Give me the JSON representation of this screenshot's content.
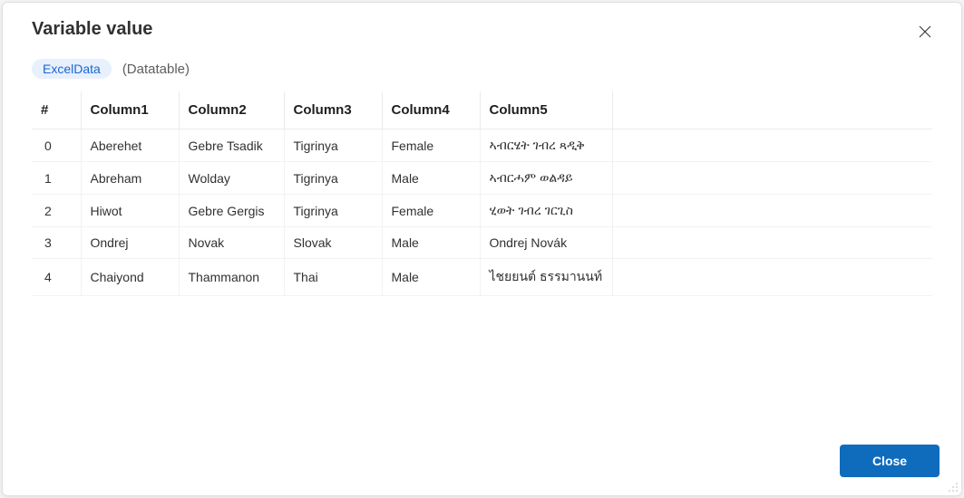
{
  "dialog": {
    "title": "Variable value",
    "variable_name": "ExcelData",
    "variable_type": "(Datatable)",
    "close_button_label": "Close"
  },
  "table": {
    "headers": {
      "index": "#",
      "c1": "Column1",
      "c2": "Column2",
      "c3": "Column3",
      "c4": "Column4",
      "c5": "Column5"
    },
    "rows": [
      {
        "index": "0",
        "c1": "Aberehet",
        "c2": "Gebre Tsadik",
        "c3": "Tigrinya",
        "c4": "Female",
        "c5": "ኣብርሄት ገብረ ጻዲቅ"
      },
      {
        "index": "1",
        "c1": "Abreham",
        "c2": "Wolday",
        "c3": "Tigrinya",
        "c4": "Male",
        "c5": "ኣብርሓም ወልዳይ"
      },
      {
        "index": "2",
        "c1": "Hiwot",
        "c2": "Gebre Gergis",
        "c3": "Tigrinya",
        "c4": "Female",
        "c5": "ሂወት ገብረ ገርጊስ"
      },
      {
        "index": "3",
        "c1": "Ondrej",
        "c2": "Novak",
        "c3": "Slovak",
        "c4": "Male",
        "c5": "Ondrej Novák"
      },
      {
        "index": "4",
        "c1": "Chaiyond",
        "c2": "Thammanon",
        "c3": "Thai",
        "c4": "Male",
        "c5": "ไชยยนต์ ธรรมานนท์"
      }
    ]
  }
}
